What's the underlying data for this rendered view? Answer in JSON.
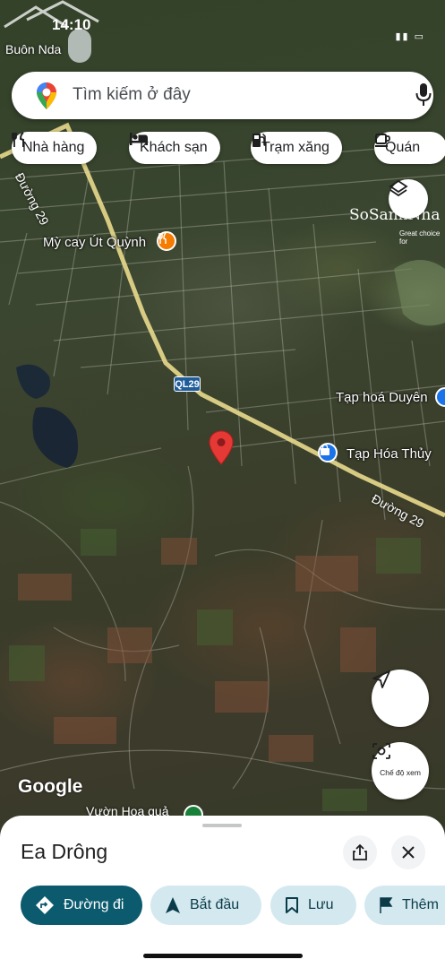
{
  "status_bar": {
    "time": "14:10",
    "top_place": "Buôn Nda"
  },
  "search": {
    "placeholder": "Tìm kiếm ở đây"
  },
  "chips": [
    "Nhà hàng",
    "Khách sạn",
    "Trạm xăng",
    "Quán"
  ],
  "watermark": {
    "text": "SoSanhNha",
    "sub": "Great choice for"
  },
  "map_labels": {
    "road_29_top": "Đường 29",
    "road_29_bottom": "Đường 29",
    "ql29": "QL29",
    "poi_restaurant": "Mỳ cay Út Quỳnh",
    "poi_store_1": "Tạp hoá Duyên",
    "poi_store_2": "Tạp Hóa Thủy",
    "peek": "Vườn Hoa quả"
  },
  "map_controls": {
    "view_mode_caption": "Chế độ xem",
    "google_logo": "Google"
  },
  "sheet": {
    "title": "Ea Drông",
    "actions": [
      "Đường đi",
      "Bắt đầu",
      "Lưu",
      "Thêm"
    ]
  },
  "colors": {
    "accent_dark": "#0b5a6e",
    "accent_light": "#d3e9ef",
    "pin_red": "#e53935",
    "poi_orange": "#f57c00",
    "poi_blue": "#1a73e8"
  }
}
